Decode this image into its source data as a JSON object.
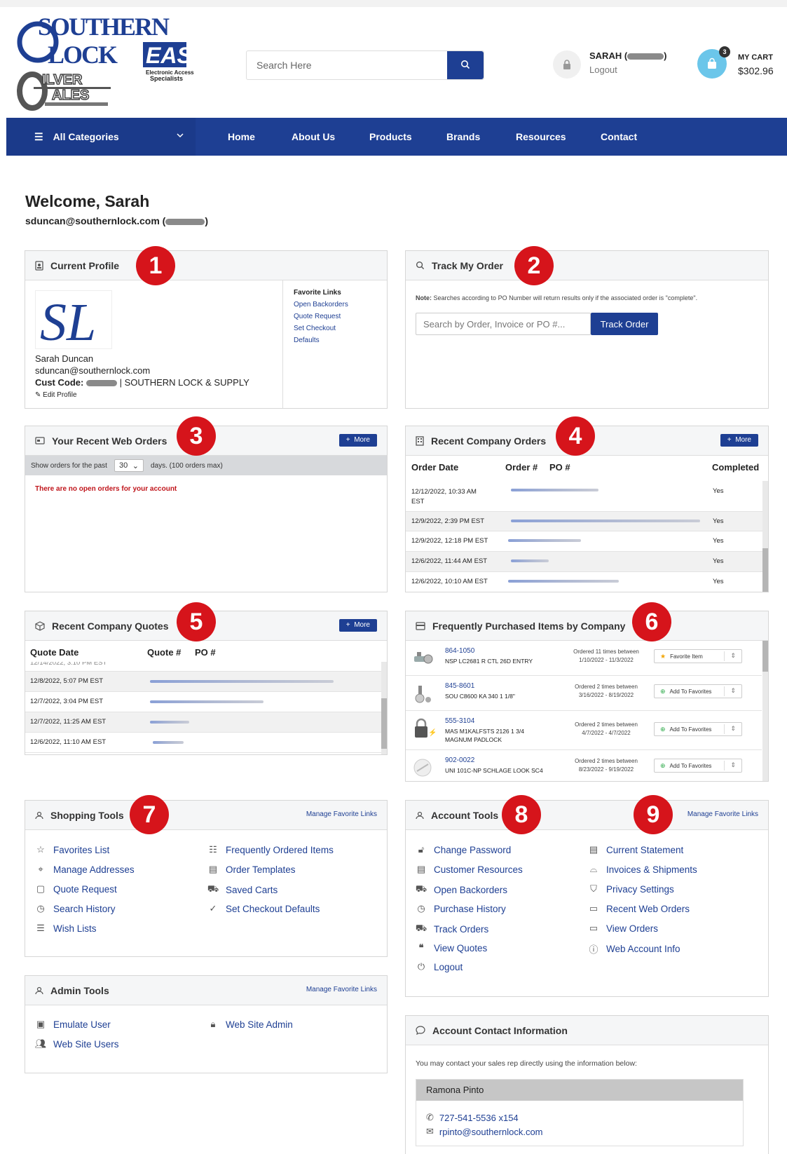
{
  "header": {
    "search_placeholder": "Search Here",
    "user_name": "SARAH (",
    "user_name_suffix": ")",
    "logout": "Logout",
    "cart_label": "MY CART",
    "cart_count": "3",
    "cart_amount": "$302.96"
  },
  "nav": {
    "all_categories": "All Categories",
    "items": [
      "Home",
      "About Us",
      "Products",
      "Brands",
      "Resources",
      "Contact"
    ]
  },
  "welcome": {
    "title": "Welcome, Sarah",
    "email": "sduncan@southernlock.com (",
    "email_suffix": ")"
  },
  "badges": [
    "1",
    "2",
    "3",
    "4",
    "5",
    "6",
    "7",
    "8",
    "9"
  ],
  "profile": {
    "title": "Current Profile",
    "name": "Sarah Duncan",
    "email": "sduncan@southernlock.com",
    "cust_code_label": "Cust Code:",
    "cust_code_company": "| SOUTHERN LOCK & SUPPLY",
    "edit": "Edit Profile",
    "fav_title": "Favorite Links",
    "fav_links": [
      "Open Backorders",
      "Quote Request",
      "Set Checkout",
      "Defaults"
    ]
  },
  "track": {
    "title": "Track My Order",
    "note_label": "Note:",
    "note": "Searches according to PO Number will return results only if the associated order is \"complete\".",
    "placeholder": "Search by Order, Invoice or PO #...",
    "button": "Track Order"
  },
  "web_orders": {
    "title": "Your Recent Web Orders",
    "more": "More",
    "show_prefix": "Show orders for the past",
    "days_value": "30",
    "show_suffix": "days. (100 orders max)",
    "empty": "There are no open orders for your account"
  },
  "company_orders": {
    "title": "Recent Company Orders",
    "more": "More",
    "columns": [
      "Order Date",
      "Order #",
      "PO #",
      "Completed"
    ],
    "rows": [
      {
        "date": "12/12/2022, 10:33 AM",
        "date2": "EST",
        "completed": "Yes"
      },
      {
        "date": "12/9/2022, 2:39 PM EST",
        "completed": "Yes"
      },
      {
        "date": "12/9/2022, 12:18 PM EST",
        "completed": "Yes"
      },
      {
        "date": "12/6/2022, 11:44 AM EST",
        "completed": "Yes"
      },
      {
        "date": "12/6/2022, 10:10 AM EST",
        "completed": "Yes"
      }
    ]
  },
  "quotes": {
    "title": "Recent Company Quotes",
    "more": "More",
    "columns": [
      "Quote Date",
      "Quote #",
      "PO #"
    ],
    "rows": [
      {
        "date": "12/8/2022, 5:07 PM EST"
      },
      {
        "date": "12/7/2022, 3:04 PM EST"
      },
      {
        "date": "12/7/2022, 11:25 AM EST"
      },
      {
        "date": "12/6/2022, 11:10 AM EST"
      }
    ]
  },
  "frequent": {
    "title": "Frequently Purchased Items by Company",
    "items": [
      {
        "code": "864-1050",
        "desc": "NSP LC2681 R CTL 26D ENTRY",
        "ordered": "Ordered 11 times between",
        "range": "1/10/2022 - 11/3/2022",
        "button": "Favorite Item"
      },
      {
        "code": "845-8601",
        "desc": "SOU C8600 KA 340 1 1/8\"",
        "ordered": "Ordered 2 times between",
        "range": "3/16/2022 - 8/19/2022",
        "button": "Add To Favorites"
      },
      {
        "code": "555-3104",
        "desc": "MAS M1KALFSTS 2126 1 3/4 MAGNUM PADLOCK",
        "ordered": "Ordered 2 times between",
        "range": "4/7/2022 - 4/7/2022",
        "button": "Add To Favorites"
      },
      {
        "code": "902-0022",
        "desc": "UNI 101C-NP SCHLAGE LOOK SC4",
        "ordered": "Ordered 2 times between",
        "range": "8/23/2022 - 9/19/2022",
        "button": "Add To Favorites"
      }
    ]
  },
  "shopping_tools": {
    "title": "Shopping Tools",
    "manage": "Manage Favorite Links",
    "left": [
      "Favorites List",
      "Manage Addresses",
      "Quote Request",
      "Search History",
      "Wish Lists"
    ],
    "right": [
      "Frequently Ordered Items",
      "Order Templates",
      "Saved Carts",
      "Set Checkout Defaults"
    ]
  },
  "account_tools": {
    "title": "Account Tools",
    "manage": "Manage Favorite Links",
    "left": [
      "Change Password",
      "Customer Resources",
      "Open Backorders",
      "Purchase History",
      "Track Orders",
      "View Quotes",
      "Logout"
    ],
    "right": [
      "Current Statement",
      "Invoices & Shipments",
      "Privacy Settings",
      "Recent Web Orders",
      "View Orders",
      "Web Account Info"
    ]
  },
  "admin_tools": {
    "title": "Admin Tools",
    "manage": "Manage Favorite Links",
    "left": [
      "Emulate User",
      "Web Site Users"
    ],
    "right": [
      "Web Site Admin"
    ]
  },
  "contact": {
    "title": "Account Contact Information",
    "note": "You may contact your sales rep directly using the information below:",
    "rep_name": "Ramona Pinto",
    "phone": "727-541-5536 x154",
    "email": "rpinto@southernlock.com"
  },
  "colors": {
    "brand": "#1e3f93",
    "badge": "#d6141b",
    "cart": "#6bc6ea"
  },
  "icons": [
    "search-icon",
    "lock-icon",
    "bag-icon",
    "menu-icon",
    "chevron-down-icon",
    "id-card-icon",
    "plus-icon",
    "star-icon",
    "phone-icon",
    "envelope-icon",
    "chat-icon"
  ]
}
